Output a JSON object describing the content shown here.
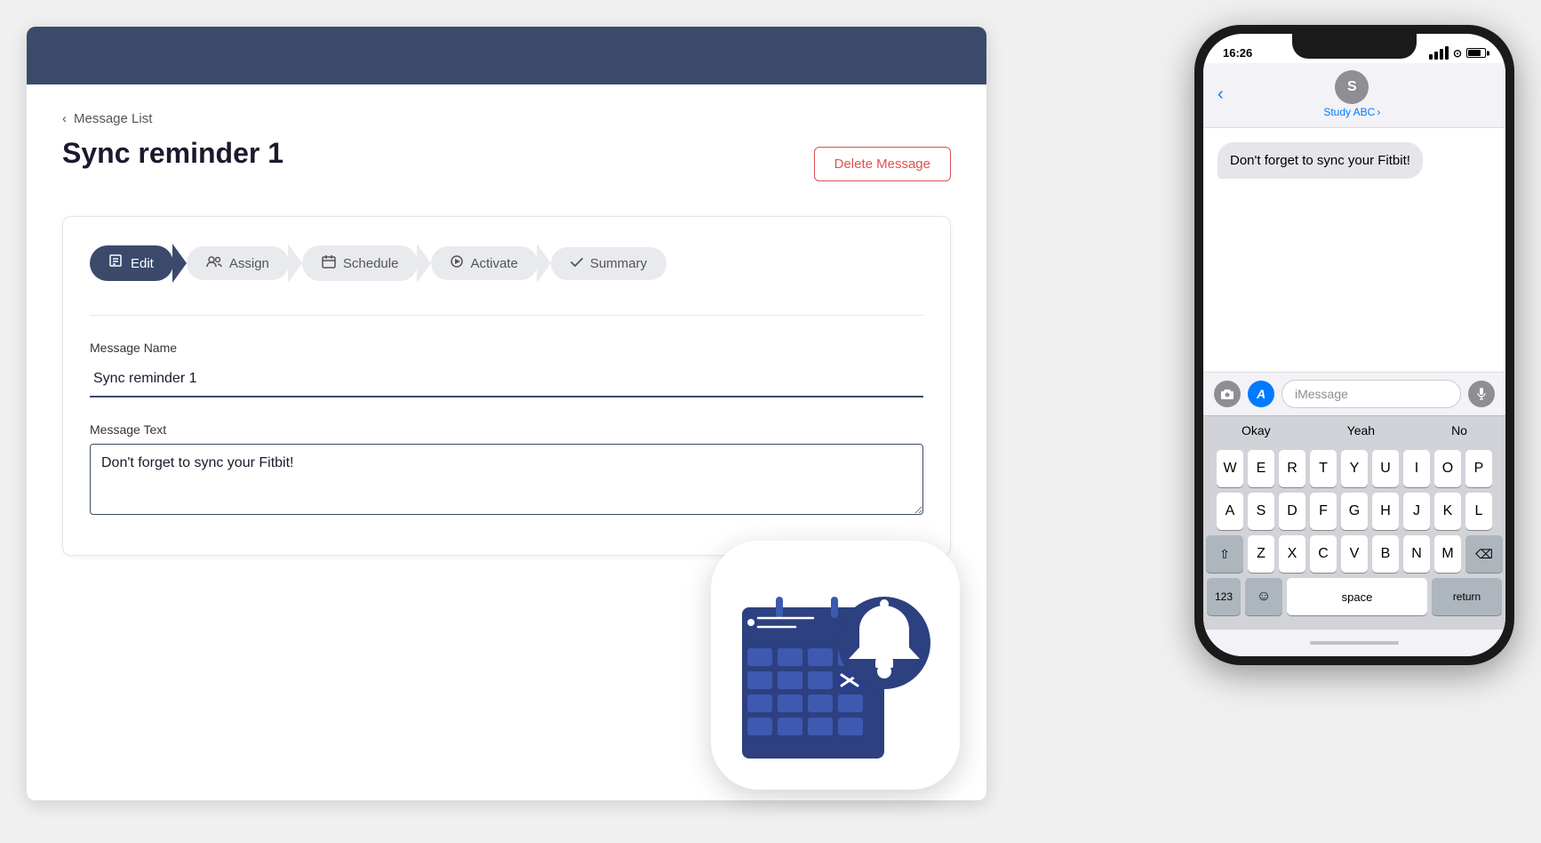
{
  "header": {
    "bg_color": "#3b4a6b"
  },
  "breadcrumb": {
    "arrow": "‹",
    "label": "Message List"
  },
  "page": {
    "title": "Sync reminder 1",
    "delete_btn": "Delete Message"
  },
  "stepper": {
    "steps": [
      {
        "id": "edit",
        "icon": "✎",
        "label": "Edit",
        "active": true
      },
      {
        "id": "assign",
        "icon": "👥",
        "label": "Assign",
        "active": false
      },
      {
        "id": "schedule",
        "icon": "📅",
        "label": "Schedule",
        "active": false
      },
      {
        "id": "activate",
        "icon": "▶",
        "label": "Activate",
        "active": false
      },
      {
        "id": "summary",
        "icon": "✓",
        "label": "Summary",
        "active": false
      }
    ]
  },
  "form": {
    "name_label": "Message Name",
    "name_value": "Sync reminder 1",
    "text_label": "Message Text",
    "text_value": "Don't forget to sync your Fitbit!"
  },
  "phone": {
    "time": "16:26",
    "contact_initial": "S",
    "contact_name": "Study ABC",
    "contact_chevron": "›",
    "back_arrow": "‹",
    "message_bubble": "Don't forget to sync your Fitbit!",
    "imessage_placeholder": "iMessage",
    "quicktype": [
      "Okay",
      "Yeah",
      "No"
    ],
    "keyboard_rows": [
      [
        "W",
        "E",
        "R",
        "T",
        "Y",
        "U",
        "I",
        "O",
        "P"
      ],
      [
        "A",
        "S",
        "D",
        "F",
        "G",
        "H",
        "J",
        "K",
        "L"
      ],
      [
        "Z",
        "X",
        "C",
        "V",
        "B",
        "N",
        "M"
      ],
      [
        "123",
        "space",
        "return"
      ]
    ]
  }
}
